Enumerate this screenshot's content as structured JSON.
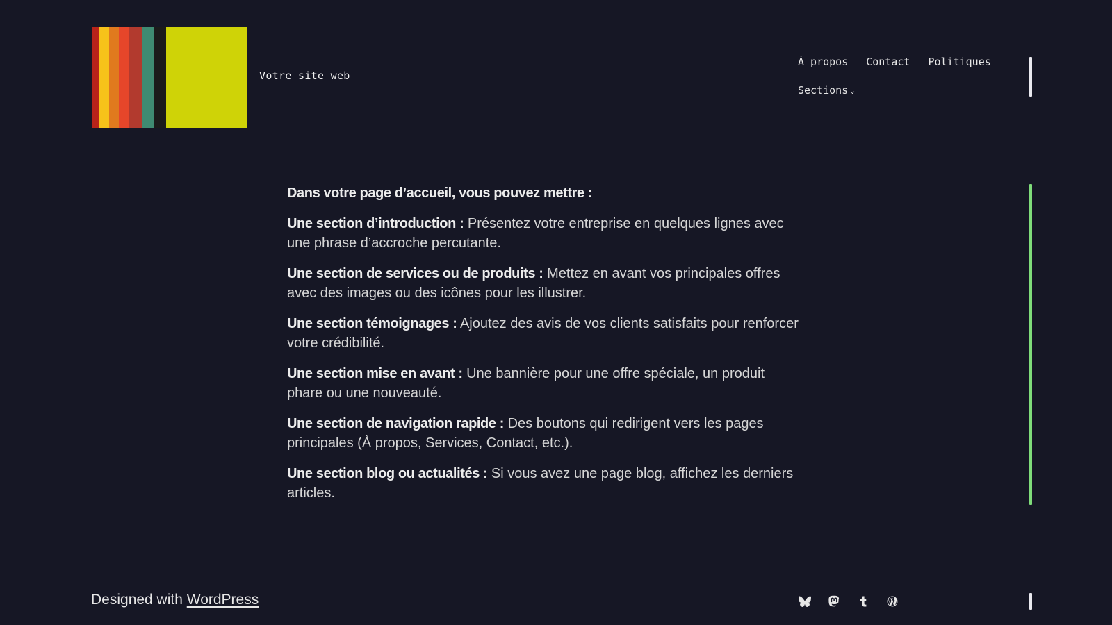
{
  "header": {
    "site_title": "Votre site web",
    "logo_colors": [
      "#b8231a",
      "#f7c21a",
      "#e07a1e",
      "#e6462a",
      "#b23a2e",
      "#3f8b72",
      "#1b1b1b",
      "#cfd307"
    ]
  },
  "nav": {
    "items": [
      {
        "label": "À propos"
      },
      {
        "label": "Contact"
      },
      {
        "label": "Politiques"
      },
      {
        "label": "Sections"
      }
    ],
    "dropdown_chevron": "⌄"
  },
  "content": {
    "intro": "Dans votre page d’accueil, vous pouvez mettre :",
    "sections": [
      {
        "title": "Une section d’introduction :",
        "text": " Présentez votre entreprise en quelques lignes avec une phrase d’accroche percutante."
      },
      {
        "title": "Une section de services ou de produits :",
        "text": " Mettez en avant vos principales offres avec des images ou des icônes pour les illustrer."
      },
      {
        "title": "Une section témoignages :",
        "text": " Ajoutez des avis de vos clients satisfaits pour renforcer votre crédibilité."
      },
      {
        "title": "Une section mise en avant :",
        "text": " Une bannière pour une offre spéciale, un produit phare ou une nouveauté."
      },
      {
        "title": "Une section de navigation rapide :",
        "text": " Des boutons qui redirigent vers les pages principales (À propos, Services, Contact, etc.)."
      },
      {
        "title": "Une section blog ou actualités :",
        "text": " Si vous avez une page blog, affichez les derniers articles."
      }
    ]
  },
  "footer": {
    "designed_with": "Designed with ",
    "link_label": "WordPress",
    "social_icons": [
      "bluesky-icon",
      "mastodon-icon",
      "tumblr-icon",
      "wordpress-icon"
    ]
  },
  "colors": {
    "background": "#161725",
    "accent_bar": "#7fdc7a",
    "text": "#d6d6d6"
  }
}
